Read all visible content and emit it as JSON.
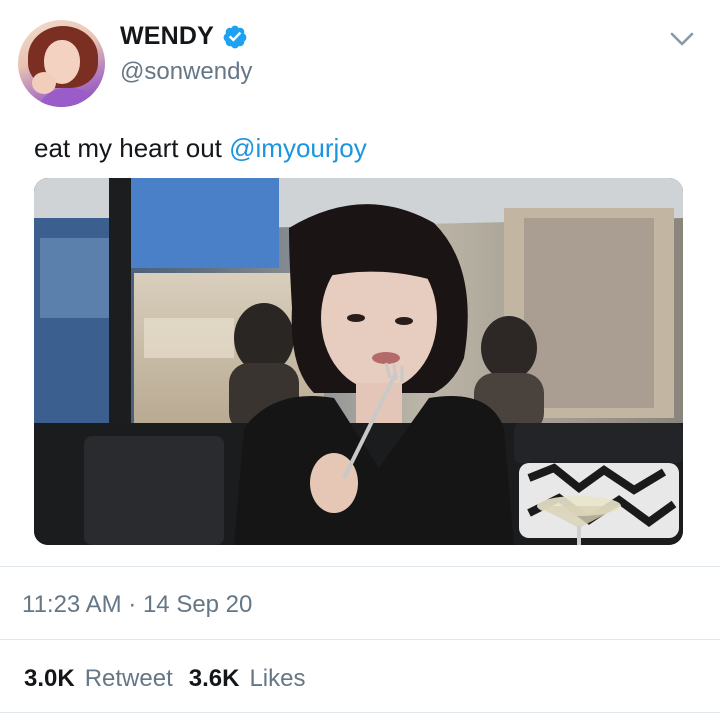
{
  "author": {
    "display_name": "WENDY",
    "handle": "@sonwendy",
    "verified": true,
    "avatar_icon": "profile-photo"
  },
  "tweet": {
    "text": "eat my heart out ",
    "mention": "@imyourjoy",
    "media_description_icon": "photo"
  },
  "meta": {
    "timestamp": "11:23 AM · 14 Sep 20"
  },
  "stats": {
    "retweets_count": "3.0K",
    "retweets_label": "Retweet",
    "likes_count": "3.6K",
    "likes_label": "Likes"
  },
  "colors": {
    "link": "#1b95e0",
    "muted": "#657786",
    "verified_badge": "#1da1f2"
  }
}
